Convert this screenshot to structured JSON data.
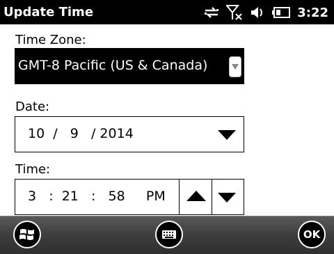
{
  "statusbar": {
    "title": "Update Time",
    "clock": "3:22",
    "icons": [
      "sync-icon",
      "no-signal-icon",
      "speaker-icon",
      "battery-icon"
    ]
  },
  "form": {
    "timezone_label": "Time Zone:",
    "timezone_value": "GMT-8 Pacific (US & Canada)",
    "date_label": "Date:",
    "date_value": "10  /   9   / 2014",
    "time_label": "Time:",
    "time_value": "3   :  21   :   58     PM"
  },
  "softkeys": {
    "ok_label": "OK"
  }
}
